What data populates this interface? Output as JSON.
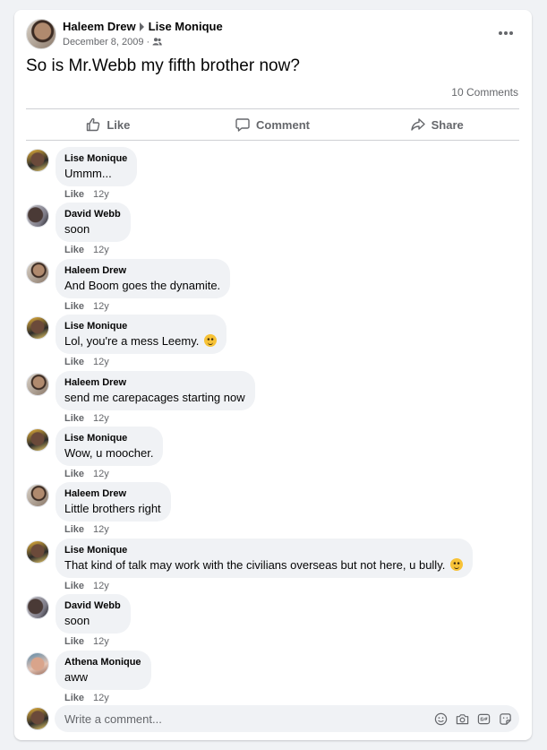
{
  "post": {
    "author": "Haleem Drew",
    "recipient": "Lise Monique",
    "date": "December 8, 2009",
    "separator": "·",
    "audience_icon": "friends-icon",
    "text": "So is Mr.Webb my fifth brother now?",
    "comments_count": "10 Comments"
  },
  "actions": {
    "like": "Like",
    "comment": "Comment",
    "share": "Share"
  },
  "comments": [
    {
      "author": "Lise Monique",
      "text": "Ummm...",
      "emoji": false,
      "like": "Like",
      "time": "12y"
    },
    {
      "author": "David Webb",
      "text": "soon",
      "emoji": false,
      "like": "Like",
      "time": "12y"
    },
    {
      "author": "Haleem Drew",
      "text": "And Boom goes the dynamite.",
      "emoji": false,
      "like": "Like",
      "time": "12y"
    },
    {
      "author": "Lise Monique",
      "text": "Lol, you're a mess Leemy.",
      "emoji": true,
      "like": "Like",
      "time": "12y"
    },
    {
      "author": "Haleem Drew",
      "text": "send me carepacages starting now",
      "emoji": false,
      "like": "Like",
      "time": "12y"
    },
    {
      "author": "Lise Monique",
      "text": "Wow, u moocher.",
      "emoji": false,
      "like": "Like",
      "time": "12y"
    },
    {
      "author": "Haleem Drew",
      "text": "Little brothers right",
      "emoji": false,
      "like": "Like",
      "time": "12y"
    },
    {
      "author": "Lise Monique",
      "text": "That kind of talk may work with the civilians overseas but not here, u bully.",
      "emoji": true,
      "like": "Like",
      "time": "12y"
    },
    {
      "author": "David Webb",
      "text": "soon",
      "emoji": false,
      "like": "Like",
      "time": "12y"
    },
    {
      "author": "Athena Monique",
      "text": "aww",
      "emoji": false,
      "like": "Like",
      "time": "12y"
    }
  ],
  "composer": {
    "placeholder": "Write a comment...",
    "icons": [
      "emoji-icon",
      "camera-icon",
      "gif-icon",
      "sticker-icon"
    ]
  },
  "colors": {
    "secondary_text": "#65676b",
    "bubble": "#f0f2f5",
    "background": "#f0f2f5"
  }
}
